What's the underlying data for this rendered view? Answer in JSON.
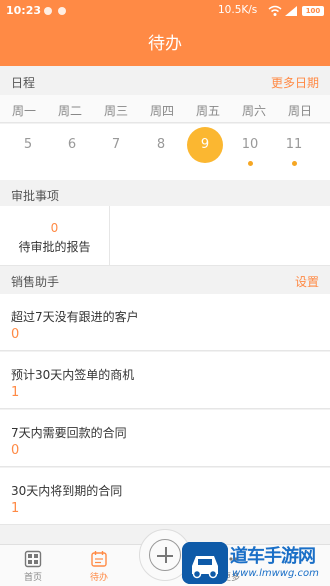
{
  "status_bar": {
    "time": "10:23",
    "speed": "10.5K/s",
    "battery": "100"
  },
  "header": {
    "title": "待办"
  },
  "schedule": {
    "title": "日程",
    "more_label": "更多日期",
    "weekdays": [
      "周一",
      "周二",
      "周三",
      "周四",
      "周五",
      "周六",
      "周日"
    ],
    "dates": [
      "5",
      "6",
      "7",
      "8",
      "9",
      "10",
      "11"
    ],
    "selected_date": "9",
    "dates_with_events": [
      "10",
      "11"
    ]
  },
  "approval": {
    "title": "审批事项",
    "pending_count": "0",
    "pending_label": "待审批的报告"
  },
  "sales": {
    "title": "销售助手",
    "settings_label": "设置",
    "items": [
      {
        "label": "超过7天没有跟进的客户",
        "value": "0"
      },
      {
        "label": "预计30天内签单的商机",
        "value": "1"
      },
      {
        "label": "7天内需要回款的合同",
        "value": "0"
      },
      {
        "label": "30天内将到期的合同",
        "value": "1"
      }
    ]
  },
  "tabbar": {
    "home": "首页",
    "todo": "待办",
    "more": "更多"
  },
  "watermark": {
    "text": "道车手游网",
    "sub": "www.lmwwg.com"
  },
  "colors": {
    "accent": "#ff8a45",
    "selected_day": "#fbb731",
    "event_dot": "#f5a623"
  }
}
